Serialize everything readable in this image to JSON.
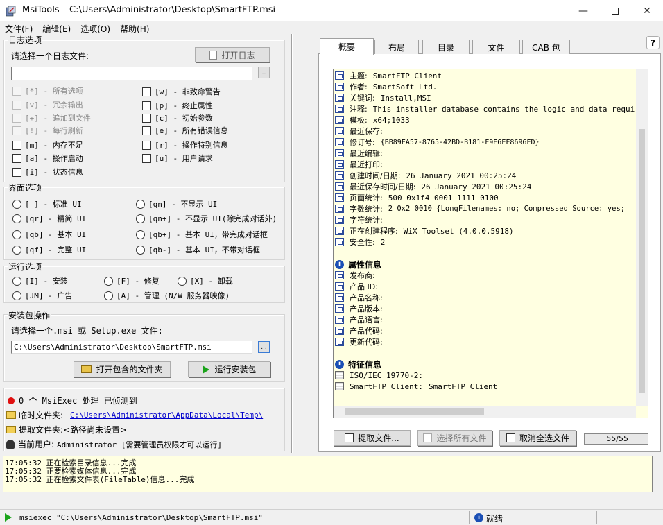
{
  "window": {
    "app_name": "MsiTools",
    "file_path": "C:\\Users\\Administrator\\Desktop\\SmartFTP.msi"
  },
  "menu": [
    "文件(F)",
    "编辑(E)",
    "选项(O)",
    "帮助(H)"
  ],
  "log_options": {
    "title": "日志选项",
    "prompt": "请选择一个日志文件:",
    "open_button": "打开日志",
    "browse": "..",
    "left": [
      {
        "label": "[*] - 所有选项",
        "disabled": true
      },
      {
        "label": "[v] - 冗余输出",
        "disabled": true
      },
      {
        "label": "[+] - 追加到文件",
        "disabled": true
      },
      {
        "label": "[!] - 每行刷新",
        "disabled": true
      },
      {
        "label": "[m] - 内存不足",
        "disabled": false
      },
      {
        "label": "[a] - 操作启动",
        "disabled": false
      },
      {
        "label": "[i] - 状态信息",
        "disabled": false
      }
    ],
    "right": [
      {
        "label": "[w] - 非致命警告"
      },
      {
        "label": "[p] - 终止属性"
      },
      {
        "label": "[c] - 初始参数"
      },
      {
        "label": "[e] - 所有错误信息"
      },
      {
        "label": "[r] - 操作特别信息"
      },
      {
        "label": "[u] - 用户请求"
      }
    ]
  },
  "ui_options": {
    "title": "界面选项",
    "left": [
      "[ ] - 标准 UI",
      "[qr] - 精简 UI",
      "[qb] - 基本 UI",
      "[qf] - 完整 UI"
    ],
    "right": [
      "[qn] - 不显示 UI",
      "[qn+] - 不显示 UI(除完成对话外)",
      "[qb+] - 基本 UI，带完成对话框",
      "[qb-] - 基本 UI，不带对话框"
    ]
  },
  "run_options": {
    "title": "运行选项",
    "items": [
      "[I] - 安装",
      "[F] - 修复",
      "[X] - 卸载",
      "[JM] - 广告",
      "[A] - 管理 (N/W 服务器映像)"
    ]
  },
  "package": {
    "title": "安装包操作",
    "prompt": "请选择一个.msi 或 Setup.exe 文件:",
    "path": "C:\\Users\\Administrator\\Desktop\\SmartFTP.msi",
    "browse": "...",
    "open_folder": "打开包含的文件夹",
    "run": "运行安装包"
  },
  "status_info": {
    "msiexec": "0 个 MsiExec 处理  已侦测到",
    "temp_label": "临时文件夹:",
    "temp_path": "C:\\Users\\Administrator\\AppData\\Local\\Temp\\",
    "extract_label": "提取文件夹:",
    "extract_value": "<路径尚未设置>",
    "user_label": "当前用户:",
    "user_value": "Administrator  [需要管理员权限才可以运行]"
  },
  "tabs": [
    "概要",
    "布局",
    "目录",
    "文件",
    "CAB 包"
  ],
  "help": "?",
  "summary": [
    {
      "k": "主题:",
      "v": "SmartFTP Client"
    },
    {
      "k": "作者:",
      "v": "SmartSoft Ltd."
    },
    {
      "k": "关键词:",
      "v": "Install,MSI"
    },
    {
      "k": "注释:",
      "v": "This installer database contains the logic and data required to"
    },
    {
      "k": "模板:",
      "v": "x64;1033"
    },
    {
      "k": "最近保存:",
      "v": ""
    },
    {
      "k": "修订号:",
      "v": "{BB89EA57-8765-42BD-B181-F9E6EF8696FD}"
    },
    {
      "k": "最近编辑:",
      "v": ""
    },
    {
      "k": "最近打印:",
      "v": ""
    },
    {
      "k": "创建时间/日期:",
      "v": "26 January 2021 00:25:24"
    },
    {
      "k": "最近保存时间/日期:",
      "v": "26 January 2021 00:25:24"
    },
    {
      "k": "页面统计:",
      "v": "500 0x1f4  0001 1111 0100"
    },
    {
      "k": "字数统计:",
      "v": "2 0x2  0010    {LongFilenames: no; Compressed Source: yes;"
    },
    {
      "k": "字符统计:",
      "v": ""
    },
    {
      "k": "正在创建程序:",
      "v": "WiX Toolset (4.0.0.5918)"
    },
    {
      "k": "安全性:",
      "v": "2"
    }
  ],
  "property_header": "属性信息",
  "properties": [
    "发布商:",
    "产品 ID:",
    "产品名称:",
    "产品版本:",
    "产品语言:",
    "产品代码:",
    "更新代码:"
  ],
  "feature_header": "特征信息",
  "features": [
    {
      "k": "ISO/IEC 19770-2:",
      "v": ""
    },
    {
      "k": "SmartFTP Client:",
      "v": "SmartFTP Client"
    }
  ],
  "bottom_buttons": {
    "extract": "提取文件...",
    "select_all": "选择所有文件",
    "deselect": "取消全选文件",
    "count": "55/55"
  },
  "log": [
    "17:05:32 正在检索目录信息...完成",
    "17:05:32 正要检索媒体信息...完成",
    "17:05:32 正在检索文件表(FileTable)信息...完成"
  ],
  "statusbar": {
    "command": "msiexec  \"C:\\Users\\Administrator\\Desktop\\SmartFTP.msi\"",
    "state": "就绪"
  }
}
